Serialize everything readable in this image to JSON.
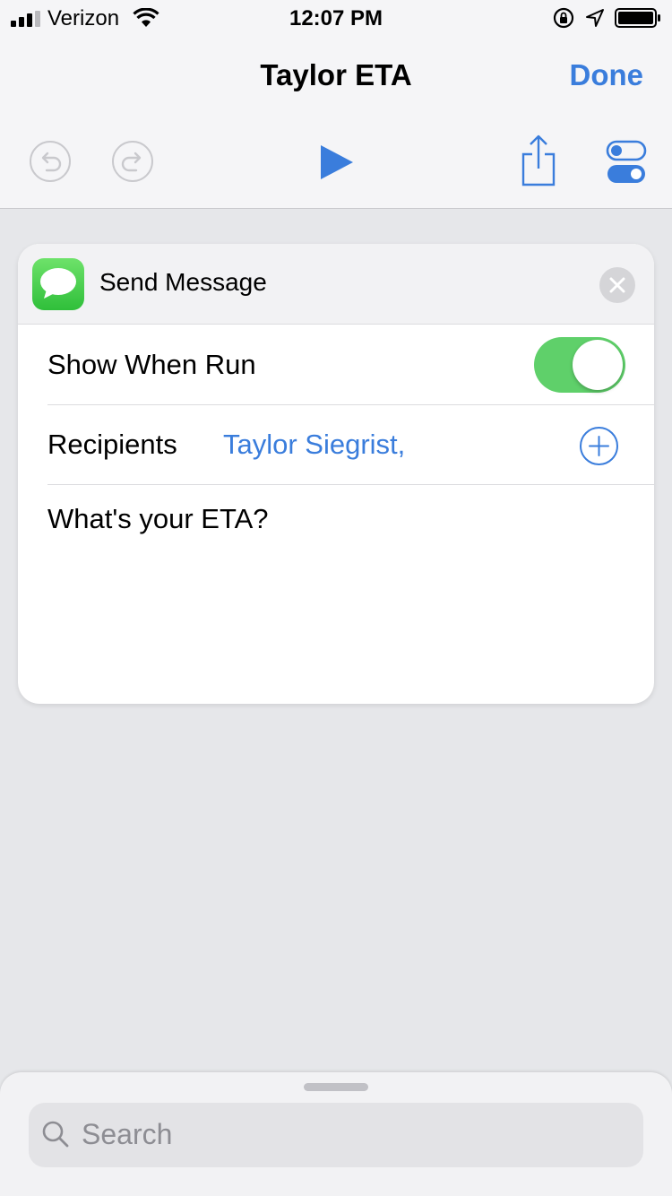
{
  "status_bar": {
    "carrier": "Verizon",
    "time": "12:07 PM"
  },
  "nav": {
    "title": "Taylor ETA",
    "done_label": "Done"
  },
  "toolbar": {
    "icons": [
      "undo-icon",
      "redo-icon",
      "play-icon",
      "share-icon",
      "settings-icon"
    ],
    "accent_color": "#3a7ddc"
  },
  "action": {
    "title": "Send Message",
    "icon": "messages-icon",
    "show_when_run_label": "Show When Run",
    "show_when_run_on": true,
    "recipients_label": "Recipients",
    "recipients_value": "Taylor Siegrist,",
    "message": "What's your ETA?",
    "toggle_color": "#5fd06a"
  },
  "sheet": {
    "search_placeholder": "Search"
  }
}
